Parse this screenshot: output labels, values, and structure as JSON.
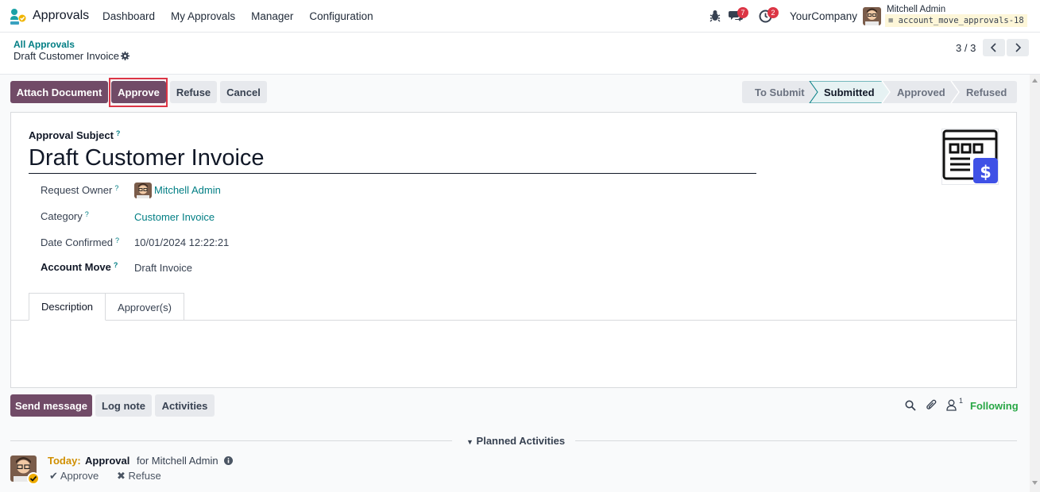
{
  "navbar": {
    "app_name": "Approvals",
    "menu": [
      "Dashboard",
      "My Approvals",
      "Manager",
      "Configuration"
    ],
    "chat_count": "7",
    "activity_count": "2",
    "company": "YourCompany",
    "user_name": "Mitchell Admin",
    "database": "account_move_approvals-18"
  },
  "breadcrumb": {
    "parent": "All Approvals",
    "current": "Draft Customer Invoice"
  },
  "pager": {
    "value": "3 / 3"
  },
  "actions": {
    "attach": "Attach Document",
    "approve": "Approve",
    "refuse": "Refuse",
    "cancel": "Cancel"
  },
  "statusbar": {
    "stages": [
      "To Submit",
      "Submitted",
      "Approved",
      "Refused"
    ],
    "current": "Submitted"
  },
  "form": {
    "subject_label": "Approval Subject",
    "subject": "Draft Customer Invoice",
    "help": "?",
    "fields": {
      "owner_label": "Request Owner",
      "owner": "Mitchell Admin",
      "category_label": "Category",
      "category": "Customer Invoice",
      "date_label": "Date Confirmed",
      "date": "10/01/2024 12:22:21",
      "move_label": "Account Move",
      "move": "Draft Invoice"
    },
    "tabs": [
      "Description",
      "Approver(s)"
    ]
  },
  "chatter": {
    "send_message": "Send message",
    "log_note": "Log note",
    "activities": "Activities",
    "followers_count": "1",
    "following": "Following",
    "planned_label": "Planned Activities",
    "activity": {
      "when": "Today:",
      "type": "Approval",
      "for": "for Mitchell Admin",
      "approve": "Approve",
      "refuse": "Refuse"
    }
  },
  "colors": {
    "primary": "#714b67",
    "link": "#017e84",
    "danger": "#dc3545",
    "success": "#28a745",
    "warning": "#d08f00"
  }
}
